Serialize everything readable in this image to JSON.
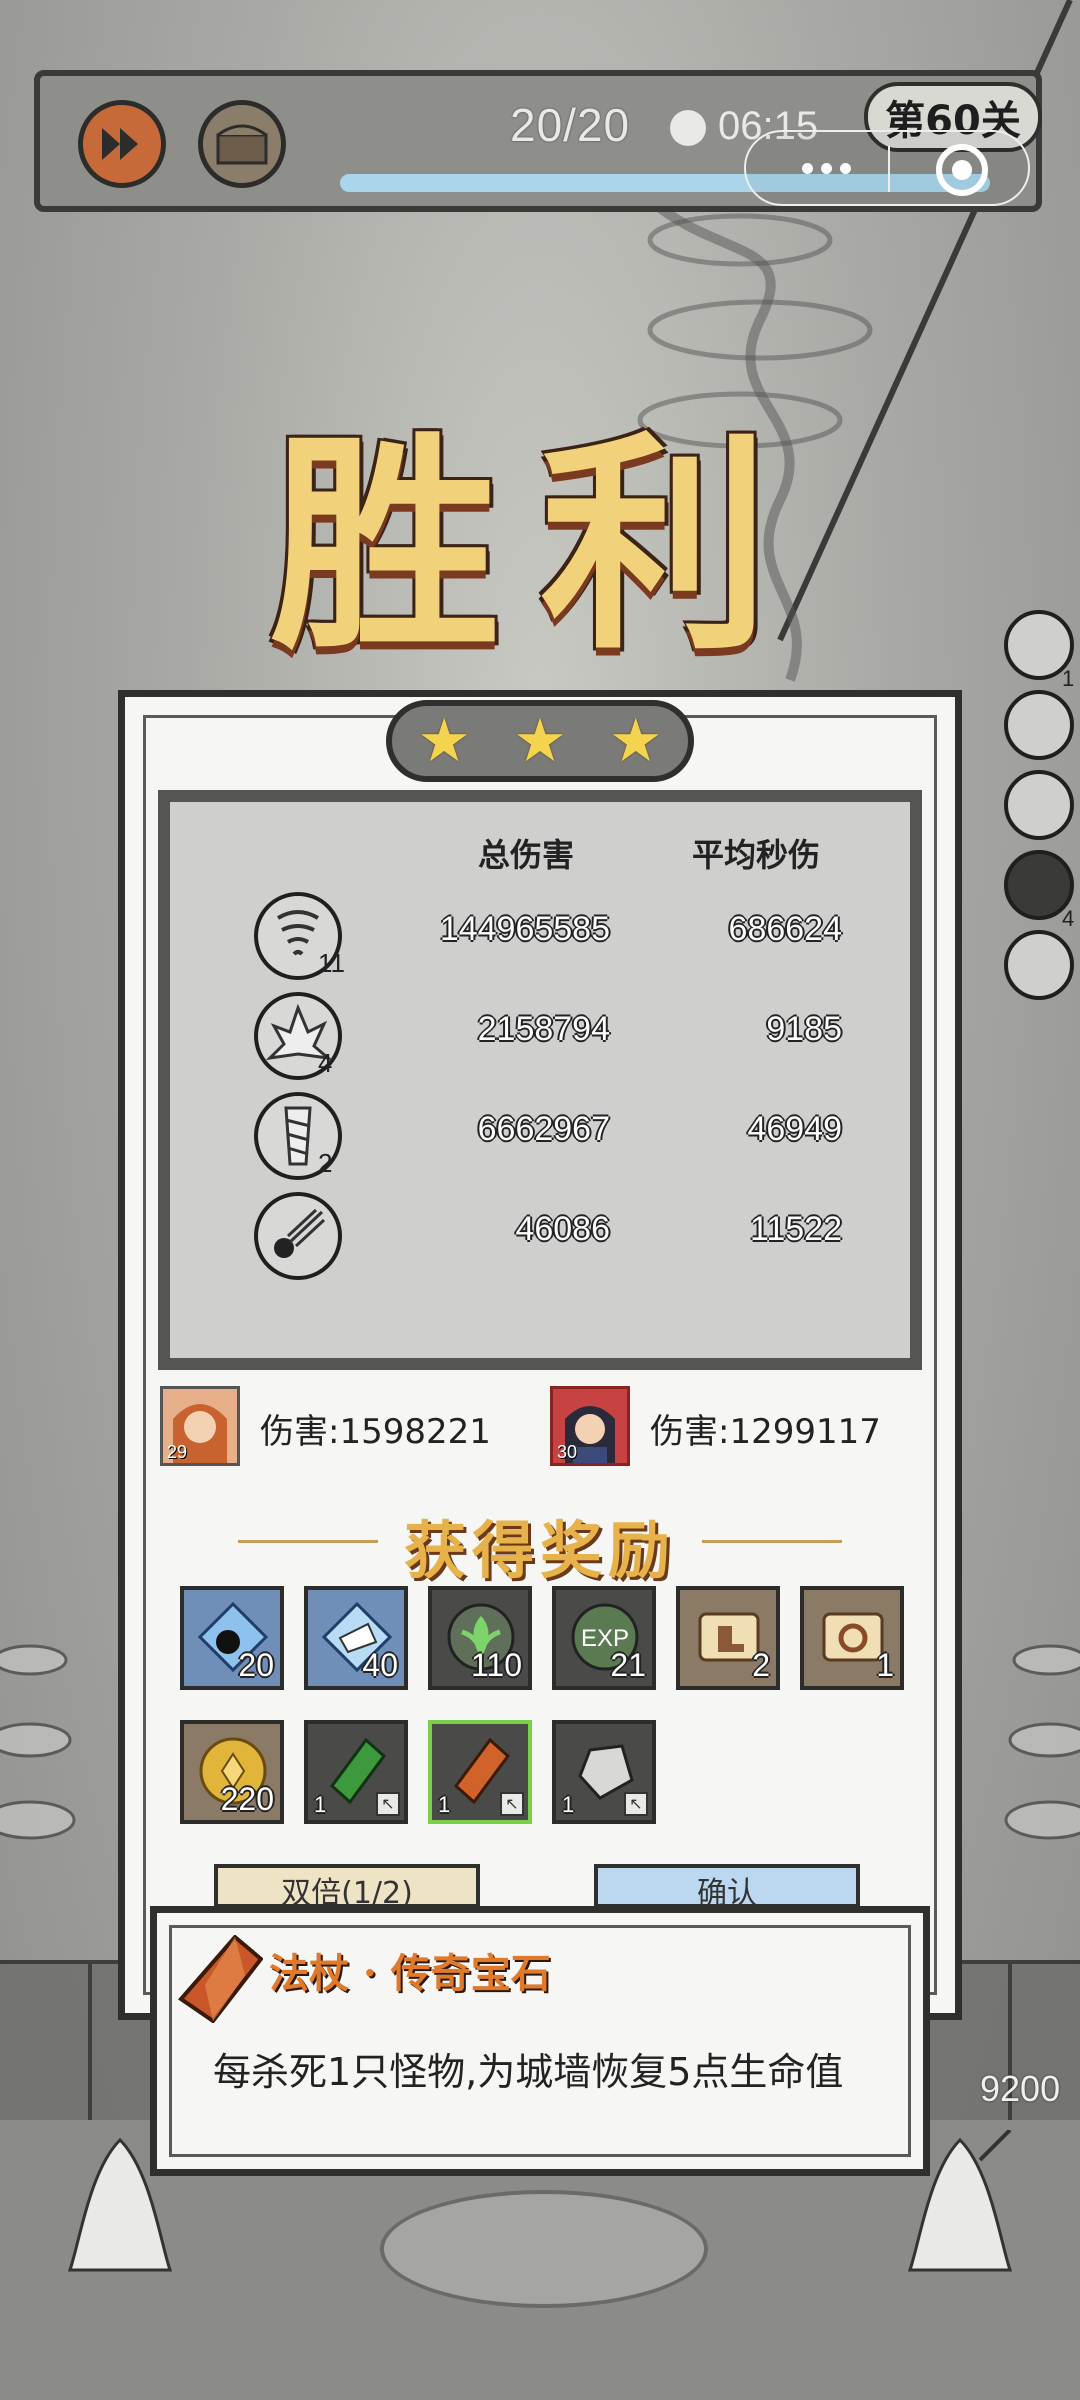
{
  "topbar": {
    "wave": "20/20",
    "time": "06:15",
    "level_badge": "第60关",
    "progress": 1.0,
    "speed_icon": "fast-forward-icon",
    "chest_icon": "treasure-chest-icon"
  },
  "title": "胜利",
  "stars": [
    "★",
    "★",
    "★"
  ],
  "stats": {
    "total_header": "总伤害",
    "avg_header": "平均秒伤",
    "rows": [
      {
        "icon": "tornado-skill-icon",
        "level": "11",
        "total": "144965585",
        "avg": "686624"
      },
      {
        "icon": "ice-crystal-skill-icon",
        "level": "4",
        "total": "2158794",
        "avg": "9185"
      },
      {
        "icon": "drill-skill-icon",
        "level": "2",
        "total": "6662967",
        "avg": "46949"
      },
      {
        "icon": "meteor-skill-icon",
        "level": "",
        "total": "46086",
        "avg": "11522"
      }
    ]
  },
  "heroes": [
    {
      "level": "29",
      "damage": "伤害:1598221",
      "avatar": "orange-hair-hero-avatar"
    },
    {
      "level": "30",
      "damage": "伤害:1299117",
      "avatar": "dark-hair-hero-avatar"
    }
  ],
  "rewards_title": "获得奖励",
  "rewards": [
    {
      "icon": "bomb-crystal-icon",
      "count": "20"
    },
    {
      "icon": "ice-shard-icon",
      "count": "40"
    },
    {
      "icon": "green-leaf-icon",
      "count": "110"
    },
    {
      "icon": "exp-orb-icon",
      "count": "21"
    },
    {
      "icon": "boot-scroll-icon",
      "count": "2"
    },
    {
      "icon": "ring-scroll-icon",
      "count": "1"
    },
    {
      "icon": "gold-coin-icon",
      "count": "220"
    },
    {
      "icon": "green-gem-icon",
      "count": "1"
    },
    {
      "icon": "orange-gem-icon",
      "count": "1"
    },
    {
      "icon": "silver-gem-icon",
      "count": "1"
    }
  ],
  "buttons": {
    "left": "双倍(1/2)",
    "right": "确认"
  },
  "tooltip": {
    "title": "法杖 · 传奇宝石",
    "desc": "每杀死1只怪物,为城墙恢复5点生命值"
  },
  "wall_hp": "9200",
  "side_skill_levels": [
    "1",
    "4"
  ],
  "colors": {
    "star": "#f4d44f",
    "victory_text": "#f1d27a",
    "reward_title": "#e7b24a",
    "tooltip_title": "#e07a2a"
  }
}
